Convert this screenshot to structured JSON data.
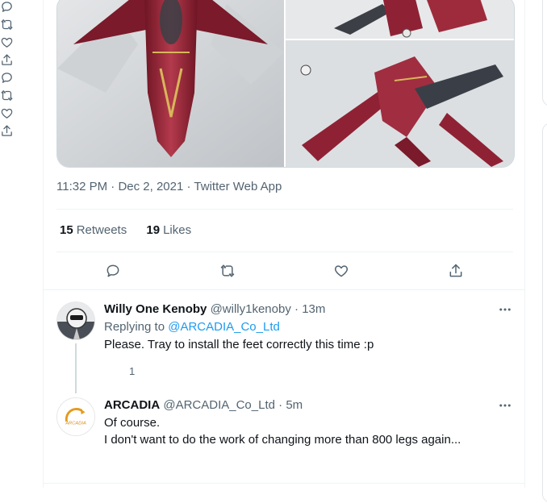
{
  "tweet": {
    "time": "11:32 PM",
    "date": "Dec 2, 2021",
    "client": "Twitter Web App",
    "separator": "·",
    "retweets_count": "15",
    "retweets_label": "Retweets",
    "likes_count": "19",
    "likes_label": "Likes"
  },
  "replies": [
    {
      "name": "Willy One Kenoby",
      "handle": "@willy1kenoby",
      "separator": "·",
      "time": "13m",
      "replying_to_label": "Replying to",
      "replying_to": "@ARCADIA_Co_Ltd",
      "text": "Please. Tray to install the feet correctly this time :p",
      "reply_count": "1"
    },
    {
      "name": "ARCADIA",
      "handle": "@ARCADIA_Co_Ltd",
      "separator": "·",
      "time": "5m",
      "text_line1": "Of course.",
      "text_line2": "I don't want to do the work of changing more than 800 legs again...",
      "avatar_text": "ARCADIA"
    }
  ],
  "colors": {
    "accent": "#1d9bf0",
    "secondary_text": "#536471",
    "primary_text": "#0f1419",
    "border": "#eff3f4",
    "model_red": "#8e2234"
  },
  "icons": [
    "reply-icon",
    "retweet-icon",
    "like-icon",
    "share-icon",
    "more-icon"
  ]
}
